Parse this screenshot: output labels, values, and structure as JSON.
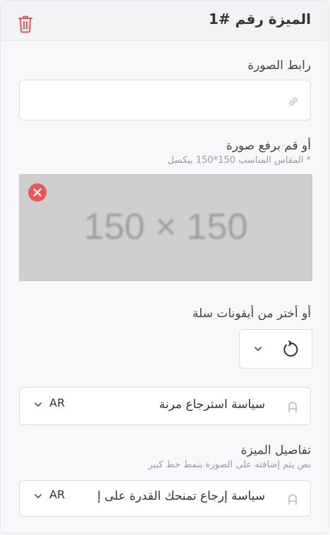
{
  "header": {
    "title": "الميزة رقم #1"
  },
  "image_url": {
    "label": "رابط الصورة",
    "placeholder": ""
  },
  "upload": {
    "label": "أو قم برفع صورة",
    "hint": "* المقاس المناسب 150*150 بيكسل",
    "preview_text": "150 × 150"
  },
  "icon_select": {
    "label": "أو أختر من أيقونات سلة"
  },
  "feature_title": {
    "value": "سياسة استرجاع مرنة",
    "lang": "AR"
  },
  "feature_details": {
    "label": "تفاصيل الميزة",
    "hint": "نص يتم إضافته على الصورة بنمط خط كبير",
    "value": "سياسة إرجاع تمنحك القدرة على إ",
    "lang": "AR"
  },
  "colors": {
    "danger": "#e8585a",
    "trash": "#e0575b",
    "border": "#dcdce2"
  }
}
